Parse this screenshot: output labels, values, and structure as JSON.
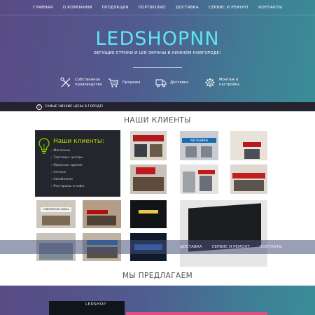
{
  "nav": {
    "items": [
      "ГЛАВНАЯ",
      "О КОМПАНИИ",
      "ПРОДУКЦИЯ",
      "ПОРТФОЛИО",
      "ДОСТАВКА",
      "СЕРВИС И РЕМОНТ",
      "КОНТАКТЫ"
    ]
  },
  "hero": {
    "brand": "LEDSHOPNN",
    "tagline": "БЕГУЩИЕ СТРОКИ И LED ЭКРАНЫ В НИЖНЕМ НОВГОРОДЕ!",
    "features": [
      {
        "icon": "tools-icon",
        "label": "Собственное\nпроизводство"
      },
      {
        "icon": "cart-icon",
        "label": "Продажа"
      },
      {
        "icon": "truck-icon",
        "label": "Доставка"
      },
      {
        "icon": "gear-icon",
        "label": "Монтаж и\nнастройка"
      }
    ]
  },
  "strip": {
    "icon": "info-icon",
    "text": "САМЫЕ НИЗКИЕ ЦЕНЫ В ГОРОДЕ!"
  },
  "clients": {
    "title": "НАШИ КЛИЕНТЫ",
    "box_title": "Наши клиенты:",
    "items": [
      "Магазины",
      "Торговые центры",
      "Офисные здания",
      "Аптеки",
      "Автобизнес",
      "Рестораны и кафе"
    ],
    "photo_signs": [
      "",
      "АВТОШИНЫ",
      "",
      "",
      "",
      "",
      "СУВЕНИРНАЯ ЛАВКА",
      "",
      "",
      "",
      "",
      ""
    ]
  },
  "overlay_nav": {
    "items": [
      "ДОСТАВКА",
      "СЕРВИС И РЕМОНТ",
      "КОНТАКТЫ"
    ]
  },
  "offer": {
    "title": "МЫ ПРЕДЛАГАЕМ",
    "image_text": "LEDSHOP"
  },
  "colors": {
    "hero_start": "#5a4a86",
    "hero_end": "#3a8d98",
    "brand": "#5ee6f0",
    "box_bg": "#23262d",
    "box_title": "#c8d700",
    "strip_bg": "#23222e",
    "accent_pink": "#e0507e"
  }
}
